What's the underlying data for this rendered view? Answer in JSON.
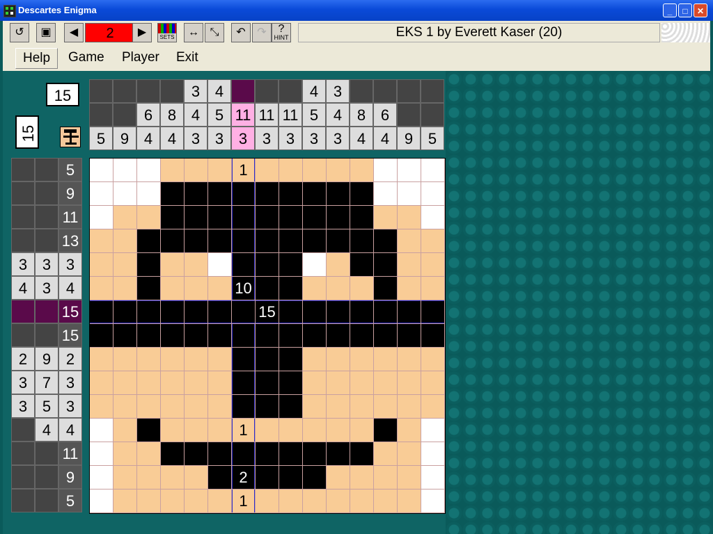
{
  "window": {
    "title": "Descartes Enigma",
    "minimize": "_",
    "maximize": "□",
    "close": "✕"
  },
  "toolbar": {
    "page_number": "2",
    "puzzle_title": "EKS 1 by Everett Kaser (20)",
    "sets_label": "SETS",
    "hint_label": "HINT",
    "icons": [
      "restart-icon",
      "save-icon",
      "prev-icon",
      "next-icon",
      "sets-icon",
      "expand-icon",
      "shrink-icon",
      "undo-icon",
      "redo-icon",
      "hint-icon"
    ]
  },
  "menu": {
    "help": "Help",
    "game": "Game",
    "player": "Player",
    "exit": "Exit"
  },
  "puzzle": {
    "width_count": "15",
    "height_count": "15",
    "column_clues": [
      [
        "",
        "",
        "5"
      ],
      [
        "",
        "",
        "9"
      ],
      [
        "",
        "6",
        "4"
      ],
      [
        "",
        "8",
        "4"
      ],
      [
        "3",
        "4",
        "3"
      ],
      [
        "4",
        "5",
        "3"
      ],
      [
        "",
        "11",
        "3"
      ],
      [
        "",
        "11",
        "3"
      ],
      [
        "",
        "11",
        "3"
      ],
      [
        "4",
        "5",
        "3"
      ],
      [
        "3",
        "4",
        "3"
      ],
      [
        "",
        "8",
        "4"
      ],
      [
        "",
        "6",
        "4"
      ],
      [
        "",
        "",
        "9"
      ],
      [
        "",
        "",
        "5"
      ]
    ],
    "row_clues": [
      [
        "",
        "",
        "5"
      ],
      [
        "",
        "",
        "9"
      ],
      [
        "",
        "",
        "11"
      ],
      [
        "",
        "",
        "13"
      ],
      [
        "3",
        "3",
        "3"
      ],
      [
        "4",
        "3",
        "4"
      ],
      [
        "",
        "",
        "15"
      ],
      [
        "",
        "",
        "15"
      ],
      [
        "2",
        "9",
        "2"
      ],
      [
        "3",
        "7",
        "3"
      ],
      [
        "3",
        "5",
        "3"
      ],
      [
        "",
        "4",
        "4"
      ],
      [
        "",
        "",
        "11"
      ],
      [
        "",
        "",
        "9"
      ],
      [
        "",
        "",
        "5"
      ]
    ],
    "highlight_col": 6,
    "highlight_row": 6,
    "grid": [
      "000111111111000",
      "000222222222000",
      "011222222222110",
      "112222222222211",
      "112110222012211",
      "112111222111211",
      "222222222222222",
      "222222222222222",
      "111111222111111",
      "111111222111111",
      "111111222111111",
      "012111111111210",
      "011222222222110",
      "011112222211110",
      "011111111111110"
    ],
    "cell_labels": [
      {
        "r": 0,
        "c": 6,
        "text": "1"
      },
      {
        "r": 5,
        "c": 6,
        "text": "10"
      },
      {
        "r": 6,
        "c": 7,
        "text": "15"
      },
      {
        "r": 11,
        "c": 6,
        "text": "1"
      },
      {
        "r": 13,
        "c": 6,
        "text": "2"
      },
      {
        "r": 14,
        "c": 6,
        "text": "1"
      }
    ]
  }
}
